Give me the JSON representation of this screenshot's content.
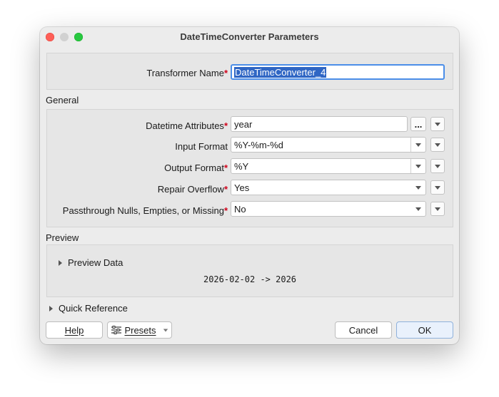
{
  "window": {
    "title": "DateTimeConverter Parameters"
  },
  "transformer": {
    "label": "Transformer Name",
    "value": "DateTimeConverter_4"
  },
  "general": {
    "heading": "General",
    "datetime_attributes": {
      "label": "Datetime Attributes",
      "value": "year",
      "ellipsis": "..."
    },
    "input_format": {
      "label": "Input Format",
      "value": "%Y-%m-%d"
    },
    "output_format": {
      "label": "Output Format",
      "value": "%Y"
    },
    "repair_overflow": {
      "label": "Repair Overflow",
      "value": "Yes"
    },
    "passthrough": {
      "label": "Passthrough Nulls, Empties, or Missing",
      "value": "No"
    }
  },
  "required_marker": "*",
  "preview": {
    "heading": "Preview",
    "toggle_label": "Preview Data",
    "output": "2026-02-02 -> 2026"
  },
  "quick_reference": {
    "label": "Quick Reference"
  },
  "buttons": {
    "help": "Help",
    "presets": "Presets",
    "cancel": "Cancel",
    "ok": "OK"
  },
  "icons": {
    "close": "close-icon",
    "minimize": "minimize-icon",
    "zoom": "zoom-icon",
    "presets": "sliders-icon"
  }
}
